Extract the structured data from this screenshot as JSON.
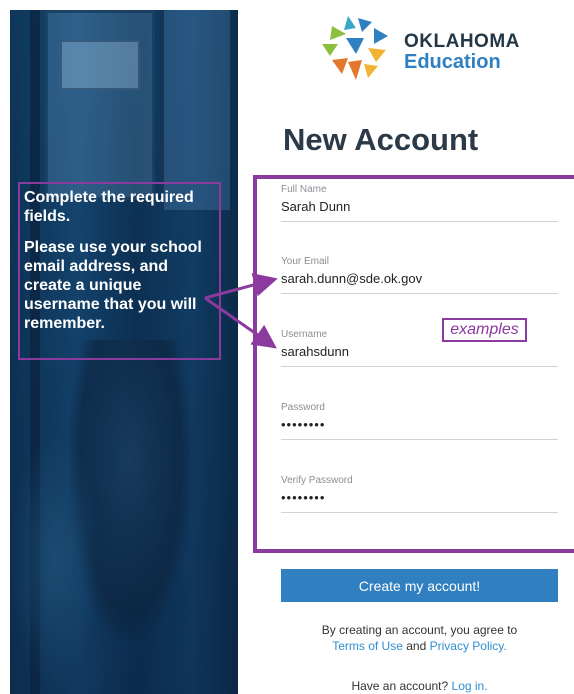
{
  "logo": {
    "line1": "OKLAHOMA",
    "line2": "Education",
    "colors": [
      "#2f7fc1",
      "#e3772b",
      "#8bbf3f",
      "#f2b233",
      "#3aa7c7"
    ]
  },
  "page_title": "New Account",
  "instructions": {
    "line1": "Complete the required fields.",
    "line2": "Please use your school email address, and create a unique username that you will remember."
  },
  "annotation": {
    "examples": "examples"
  },
  "form": {
    "full_name": {
      "label": "Full Name",
      "value": "Sarah Dunn"
    },
    "email": {
      "label": "Your Email",
      "value": "sarah.dunn@sde.ok.gov"
    },
    "username": {
      "label": "Username",
      "value": "sarahsdunn"
    },
    "password": {
      "label": "Password",
      "value": "••••••••"
    },
    "verify_password": {
      "label": "Verify Password",
      "value": "••••••••"
    }
  },
  "submit_label": "Create my account!",
  "agreement": {
    "prefix": "By creating an account, you agree to",
    "terms": "Terms of Use",
    "and": "and",
    "privacy": "Privacy Policy."
  },
  "login": {
    "prefix": "Have an account?",
    "link": "Log in."
  },
  "colors": {
    "accent": "#2f7fc1",
    "annotation": "#8b3a9e",
    "title": "#2c3946"
  }
}
